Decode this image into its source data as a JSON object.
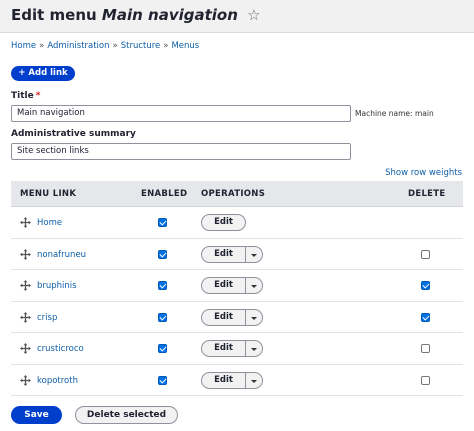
{
  "header": {
    "title_prefix": "Edit menu",
    "title_name": "Main navigation",
    "star_icon": "☆"
  },
  "breadcrumb": [
    "Home",
    "Administration",
    "Structure",
    "Menus"
  ],
  "breadcrumb_separator": "»",
  "add_link_label": "+ Add link",
  "title_field": {
    "label": "Title",
    "required_marker": "*",
    "value": "Main navigation",
    "machine_name": "Machine name: main"
  },
  "summary_field": {
    "label": "Administrative summary",
    "value": "Site section links"
  },
  "show_row_weights": "Show row weights",
  "table": {
    "headers": {
      "menu_link": "MENU LINK",
      "enabled": "ENABLED",
      "operations": "OPERATIONS",
      "delete": "DELETE"
    },
    "rows": [
      {
        "title": "Home",
        "enabled": true,
        "edit_label": "Edit",
        "has_dropdown": false,
        "has_delete": false,
        "delete": false
      },
      {
        "title": "nonafruneu",
        "enabled": true,
        "edit_label": "Edit",
        "has_dropdown": true,
        "has_delete": true,
        "delete": false
      },
      {
        "title": "bruphinis",
        "enabled": true,
        "edit_label": "Edit",
        "has_dropdown": true,
        "has_delete": true,
        "delete": true
      },
      {
        "title": "crisp",
        "enabled": true,
        "edit_label": "Edit",
        "has_dropdown": true,
        "has_delete": true,
        "delete": true
      },
      {
        "title": "crusticroco",
        "enabled": true,
        "edit_label": "Edit",
        "has_dropdown": true,
        "has_delete": true,
        "delete": false
      },
      {
        "title": "kopotroth",
        "enabled": true,
        "edit_label": "Edit",
        "has_dropdown": true,
        "has_delete": true,
        "delete": false
      }
    ]
  },
  "actions": {
    "save_label": "Save",
    "delete_selected_label": "Delete selected"
  },
  "colors": {
    "primary_button": "#003ecc",
    "link": "#0f5fa8",
    "checkbox_checked": "#0072e6"
  }
}
